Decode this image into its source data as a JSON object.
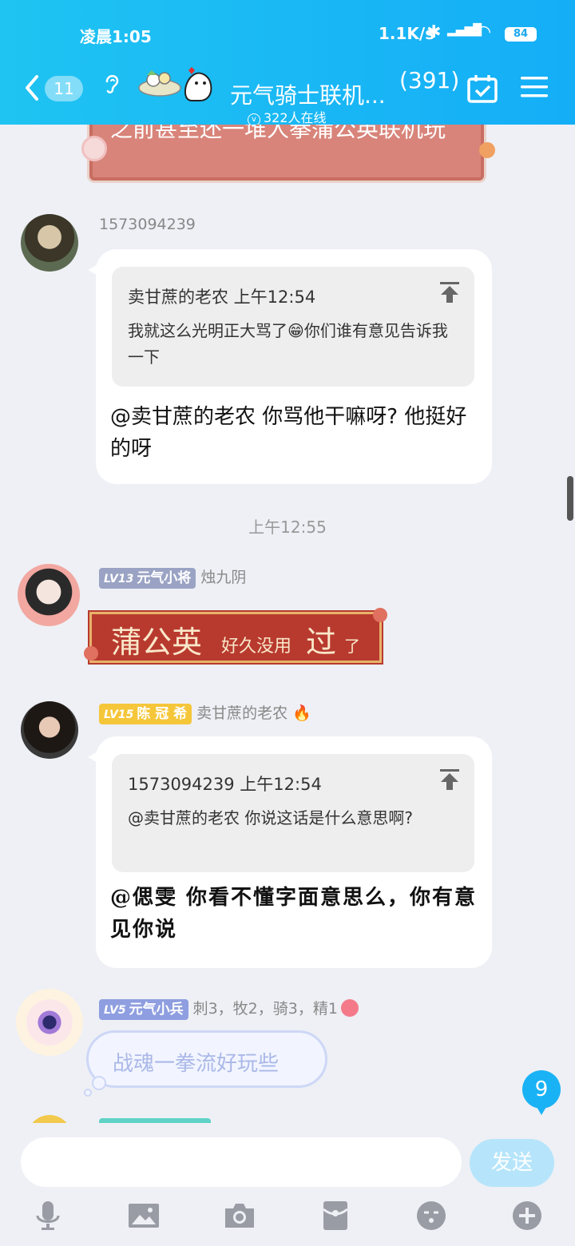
{
  "status_bar": {
    "time": "凌晨1:05",
    "net_speed": "1.1K/s",
    "battery": "84"
  },
  "header": {
    "back_badge": "11",
    "title": "元气骑士联机...",
    "member_count": "(391)",
    "online": "322人在线"
  },
  "messages": {
    "top_sticker_text": "之前甚至还一堆人拳蒲公英联机玩",
    "msg1": {
      "sender": "1573094239",
      "quote_header": "卖甘蔗的老农 上午12:54",
      "quote_body": "我就这么光明正大骂了😁你们谁有意见告诉我一下",
      "reply": "@卖甘蔗的老农 你骂他干嘛呀? 他挺好的呀"
    },
    "timestamp": "上午12:55",
    "msg2": {
      "level": "LV13",
      "title": "元气小将",
      "sender": "烛九阴",
      "banner_a": "蒲公英",
      "banner_b": "好久没用",
      "banner_c": "过",
      "banner_d": "了"
    },
    "msg3": {
      "level": "LV15",
      "title": "陈 冠 希",
      "sender": "卖甘蔗的老农",
      "quote_header": "1573094239 上午12:54",
      "quote_body": "@卖甘蔗的老农 你说这话是什么意思啊?",
      "reply": "@偲雯 你看不懂字面意思么，你有意见你说"
    },
    "msg4": {
      "level": "LV5",
      "title": "元气小兵",
      "sender": "刺3，牧2，骑3，精1",
      "text": "战魂一拳流好玩些"
    },
    "unread": "9"
  },
  "input": {
    "send_label": "发送",
    "placeholder": ""
  },
  "colors": {
    "accent": "#19b2f5",
    "lv13": "#9aa3c4",
    "lv15": "#f5c63a",
    "lv5": "#8e9ee0"
  }
}
